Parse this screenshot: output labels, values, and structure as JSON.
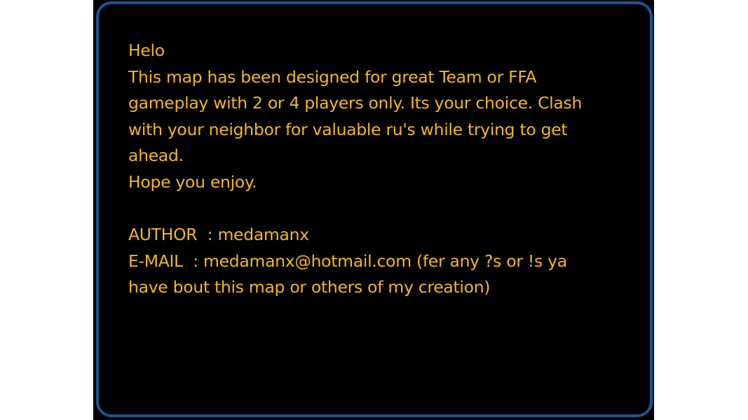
{
  "message": {
    "lines": [
      "Helo",
      "This map has been designed for great Team or FFA",
      "gameplay with 2 or 4 players only. Its your choice. Clash",
      "with your neighbor for valuable ru's while trying to get",
      "ahead.",
      "Hope you enjoy.",
      "",
      "AUTHOR  : medamanx",
      "E-MAIL  : medamanx@hotmail.com (fer any ?s or !s ya",
      "have bout this map or others of my creation)"
    ]
  },
  "colors": {
    "text": "#f2b91c",
    "border": "#1b5592",
    "background": "#000000"
  }
}
